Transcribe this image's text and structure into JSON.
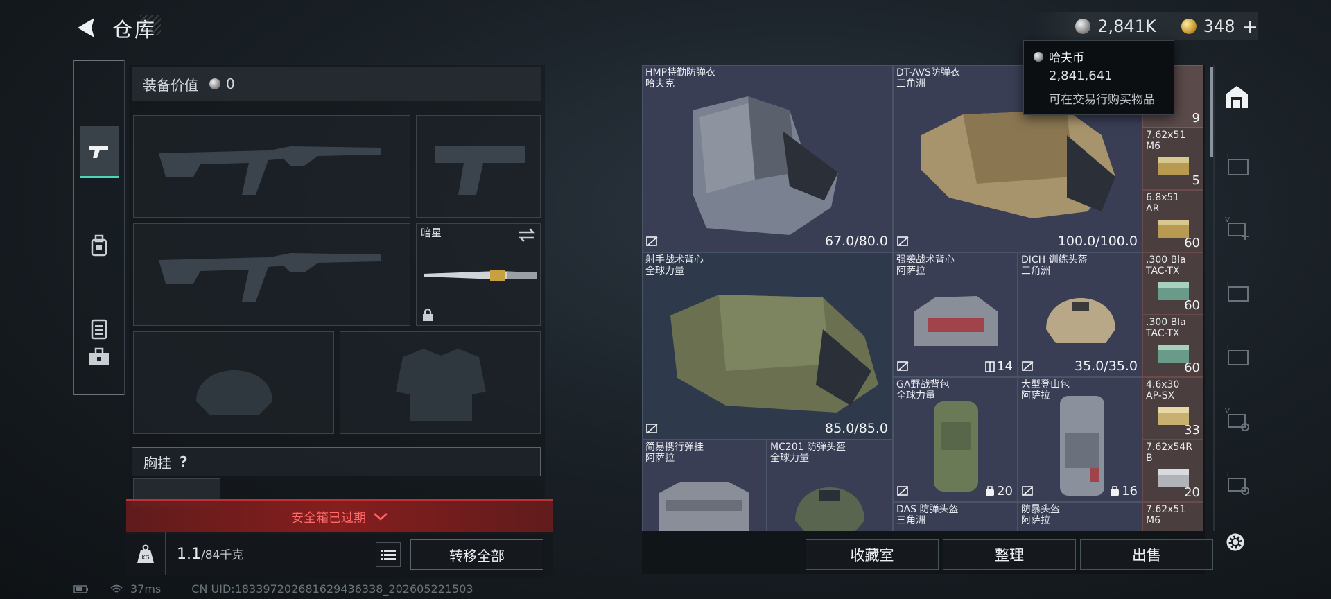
{
  "header": {
    "title": "仓库",
    "hafu_coins": "2,841K",
    "premium": "348",
    "premium_plus": "+"
  },
  "tooltip": {
    "title": "哈夫币",
    "value": "2,841,641",
    "desc": "可在交易行购买物品"
  },
  "left": {
    "equip_value_label": "装备价值",
    "equip_value": "0",
    "melee_slot_label": "暗星",
    "chest_label": "胸挂",
    "chest_help": "?",
    "expired_text": "安全箱已过期",
    "weight_current": "1.1",
    "weight_max": "/84千克",
    "transfer_all": "转移全部"
  },
  "status": {
    "ping": "37ms",
    "uid": "CN UID:183397202681629436338_202605221503"
  },
  "items": [
    {
      "name": "HMP特勤防弹衣",
      "sub": "哈夫克",
      "dur": "67.0/80.0"
    },
    {
      "name": "DT-AVS防弹衣",
      "sub": "三角洲",
      "dur": "100.0/100.0"
    },
    {
      "name": "射手战术背心",
      "sub": "全球力量",
      "dur": "85.0/85.0"
    },
    {
      "name": "强袭战术背心",
      "sub": "阿萨拉",
      "cap": "14"
    },
    {
      "name": "DICH 训练头盔",
      "sub": "三角洲",
      "dur": "35.0/35.0"
    },
    {
      "name": "GA野战背包",
      "sub": "全球力量",
      "cap": "20"
    },
    {
      "name": "大型登山包",
      "sub": "阿萨拉",
      "cap": "16"
    },
    {
      "name": "简易携行弹挂",
      "sub": "阿萨拉"
    },
    {
      "name": "MC201 防弹头盔",
      "sub": "全球力量"
    },
    {
      "name": "DAS 防弹头盔",
      "sub": "三角洲"
    },
    {
      "name": "防暴头盔",
      "sub": "阿萨拉"
    }
  ],
  "ammo": [
    {
      "name": "",
      "sub": "",
      "count": "9"
    },
    {
      "name": "7.62x51",
      "sub": "M6",
      "count": "5"
    },
    {
      "name": "6.8x51",
      "sub": "AR",
      "count": "60"
    },
    {
      "name": ".300 Bla",
      "sub": "TAC-TX",
      "count": "60"
    },
    {
      "name": ".300 Bla",
      "sub": "TAC-TX",
      "count": "60"
    },
    {
      "name": "4.6x30",
      "sub": "AP-SX",
      "count": "33"
    },
    {
      "name": "7.62x54R",
      "sub": "B",
      "count": "20"
    },
    {
      "name": "7.62x51",
      "sub": "M6",
      "count": ""
    }
  ],
  "buttons": {
    "collection": "收藏室",
    "sort": "整理",
    "sell": "出售"
  },
  "rnav_tiers": [
    "III",
    "IV",
    "III",
    "III",
    "IV",
    "III"
  ],
  "colors": {
    "accent": "#4cd8b8",
    "expired": "#ff6a6a"
  }
}
